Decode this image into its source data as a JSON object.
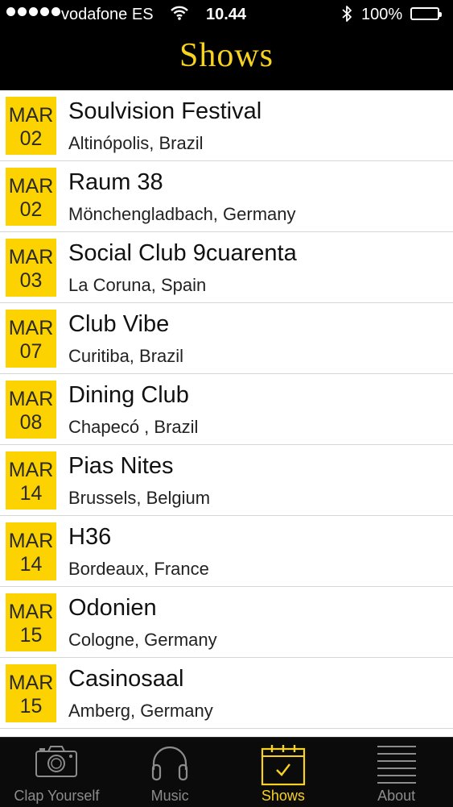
{
  "status_bar": {
    "carrier": "vodafone ES",
    "time": "10.44",
    "battery": "100%"
  },
  "header": {
    "title": "Shows"
  },
  "shows": [
    {
      "month": "MAR",
      "day": "02",
      "venue": "Soulvision Festival",
      "location": "Altinópolis, Brazil"
    },
    {
      "month": "MAR",
      "day": "02",
      "venue": "Raum 38",
      "location": "Mönchengladbach, Germany"
    },
    {
      "month": "MAR",
      "day": "03",
      "venue": "Social Club 9cuarenta",
      "location": "La Coruna, Spain"
    },
    {
      "month": "MAR",
      "day": "07",
      "venue": "Club Vibe",
      "location": "Curitiba, Brazil"
    },
    {
      "month": "MAR",
      "day": "08",
      "venue": "Dining Club",
      "location": "Chapecó , Brazil"
    },
    {
      "month": "MAR",
      "day": "14",
      "venue": "Pias Nites",
      "location": "Brussels, Belgium"
    },
    {
      "month": "MAR",
      "day": "14",
      "venue": "H36",
      "location": "Bordeaux, France"
    },
    {
      "month": "MAR",
      "day": "15",
      "venue": "Odonien",
      "location": "Cologne, Germany"
    },
    {
      "month": "MAR",
      "day": "15",
      "venue": "Casinosaal",
      "location": "Amberg, Germany"
    }
  ],
  "tab_bar": {
    "tabs": [
      {
        "label": "Clap Yourself",
        "icon": "camera-icon",
        "active": false
      },
      {
        "label": "Music",
        "icon": "headphones-icon",
        "active": false
      },
      {
        "label": "Shows",
        "icon": "calendar-icon",
        "active": true
      },
      {
        "label": "About",
        "icon": "list-icon",
        "active": false
      }
    ]
  },
  "colors": {
    "accent": "#f7d221",
    "date_badge": "#fcd200",
    "background": "#000000",
    "tab_inactive": "#8c8c8c"
  }
}
